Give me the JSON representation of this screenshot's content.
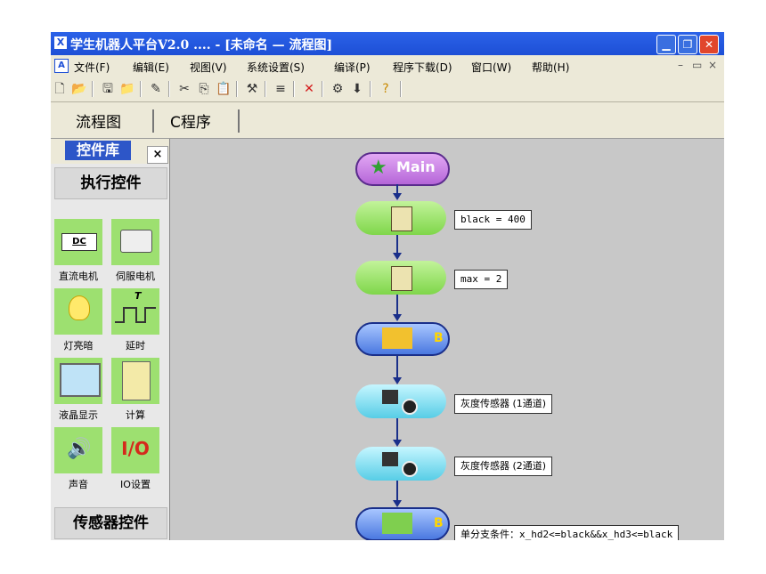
{
  "window": {
    "title": "学生机器人平台V2.0 .... - [未命名 — 流程图]",
    "icon_letter": "X",
    "buttons": [
      "minimize-icon",
      "restore-icon",
      "close-icon"
    ]
  },
  "menubar": {
    "icon_letter": "A",
    "items": [
      {
        "label": "文件(F)"
      },
      {
        "label": "编辑(E)"
      },
      {
        "label": "视图(V)"
      },
      {
        "label": "系统设置(S)"
      },
      {
        "label": "编译(P)"
      },
      {
        "label": "程序下载(D)"
      },
      {
        "label": "窗口(W)"
      },
      {
        "label": "帮助(H)"
      }
    ],
    "mdi_controls": [
      "–",
      "▭",
      "×"
    ]
  },
  "toolbar": {
    "icons": [
      "new-icon",
      "open-icon",
      "save-icon",
      "folder-icon",
      "props-icon",
      "cut-icon",
      "copy-icon",
      "paste-icon",
      "tool-icon",
      "list-icon",
      "delete-icon",
      "compile-icon",
      "download-icon",
      "help-icon"
    ]
  },
  "tabs": [
    {
      "label": "流程图"
    },
    {
      "label": "C程序"
    }
  ],
  "palette": {
    "title": "控件库",
    "close": "×",
    "section1": "执行控件",
    "items": [
      {
        "label": "直流电机",
        "icon_text": "DC"
      },
      {
        "label": "伺服电机",
        "icon_text": ""
      },
      {
        "label": "灯亮暗",
        "icon_text": ""
      },
      {
        "label": "延时",
        "icon_text": "T"
      },
      {
        "label": "液晶显示",
        "icon_text": ""
      },
      {
        "label": "计算",
        "icon_text": ""
      },
      {
        "label": "声音",
        "icon_text": ""
      },
      {
        "label": "IO设置",
        "icon_text": "I/O"
      }
    ],
    "section2": "传感器控件"
  },
  "flowchart": {
    "main": "Main",
    "badge": "B",
    "nodes": [
      {
        "type": "calc",
        "text": "black = 400"
      },
      {
        "type": "calc",
        "text": "max = 2"
      },
      {
        "type": "cond",
        "text": ""
      },
      {
        "type": "sensor",
        "text": "灰度传感器 (1通道)"
      },
      {
        "type": "sensor",
        "text": "灰度传感器 (2通道)"
      },
      {
        "type": "cond",
        "text": "单分支条件：x_hd2<=black&&x_hd3<=black"
      }
    ]
  },
  "colors": {
    "title_blue": "#1d4fd6",
    "palette_green": "#9de070",
    "node_calc": "#7fd64a",
    "node_sensor": "#57cde6",
    "node_cond": "#4a78e0",
    "node_main": "#b565d8",
    "connector": "#1a2f8a"
  }
}
